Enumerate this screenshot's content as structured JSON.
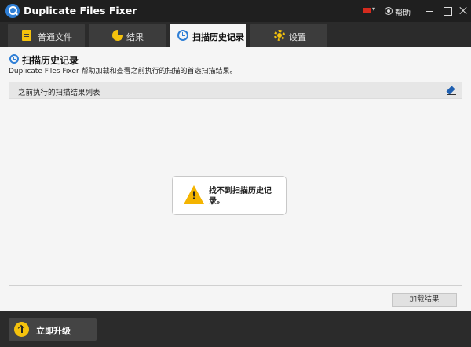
{
  "window": {
    "title": "Duplicate Files Fixer",
    "help_label": "帮助"
  },
  "tabs": [
    {
      "label": "普通文件",
      "icon": "document-icon",
      "active": false
    },
    {
      "label": "结果",
      "icon": "pie-chart-icon",
      "active": false
    },
    {
      "label": "扫描历史记录",
      "icon": "history-icon",
      "active": true
    },
    {
      "label": "设置",
      "icon": "gear-icon",
      "active": false
    }
  ],
  "page": {
    "title": "扫描历史记录",
    "description": "Duplicate Files Fixer 帮助加载和查看之前执行的扫描的首选扫描结果。",
    "list_header": "之前执行的扫描结果列表",
    "empty_message": "找不到扫描历史记录。",
    "load_button": "加载结果"
  },
  "footer": {
    "upgrade_label": "立即升级"
  },
  "colors": {
    "accent": "#2f7fd6",
    "highlight": "#f4c20d",
    "warning": "#f4b400",
    "flag": "#d52b1e"
  }
}
